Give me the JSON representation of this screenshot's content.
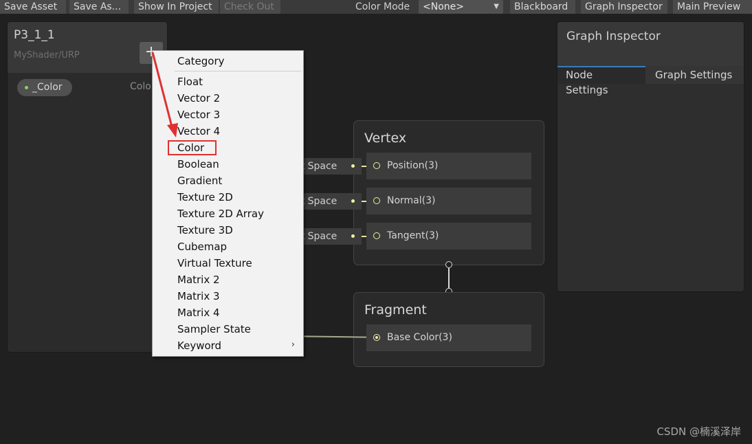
{
  "toolbar": {
    "save_asset": "Save Asset",
    "save_as": "Save As...",
    "show_in_project": "Show In Project",
    "check_out": "Check Out",
    "color_mode_label": "Color Mode",
    "color_mode_value": "<None>",
    "blackboard": "Blackboard",
    "graph_inspector": "Graph Inspector",
    "main_preview": "Main Preview"
  },
  "blackboard": {
    "title": "P3_1_1",
    "subtitle": "MyShader/URP",
    "add_symbol": "+",
    "property_name": "_Color",
    "property_type": "Color"
  },
  "inspector": {
    "title": "Graph Inspector",
    "tabs": [
      "Node Settings",
      "Graph Settings"
    ]
  },
  "vertex": {
    "title": "Vertex",
    "ports": [
      "Position(3)",
      "Normal(3)",
      "Tangent(3)"
    ],
    "inputs": [
      "ct Space",
      "ct Space",
      "ct Space"
    ]
  },
  "fragment": {
    "title": "Fragment",
    "ports": [
      "Base Color(3)"
    ]
  },
  "menu": {
    "header": "Category",
    "items": [
      "Float",
      "Vector 2",
      "Vector 3",
      "Vector 4",
      "Color",
      "Boolean",
      "Gradient",
      "Texture 2D",
      "Texture 2D Array",
      "Texture 3D",
      "Cubemap",
      "Virtual Texture",
      "Matrix 2",
      "Matrix 3",
      "Matrix 4",
      "Sampler State",
      "Keyword"
    ],
    "submenu_arrow": "›"
  },
  "watermark": "CSDN @楠溪泽岸",
  "colors": {
    "accent": "#3a79bb",
    "wire": "#e8e89a",
    "annotation_red": "#e03030"
  }
}
